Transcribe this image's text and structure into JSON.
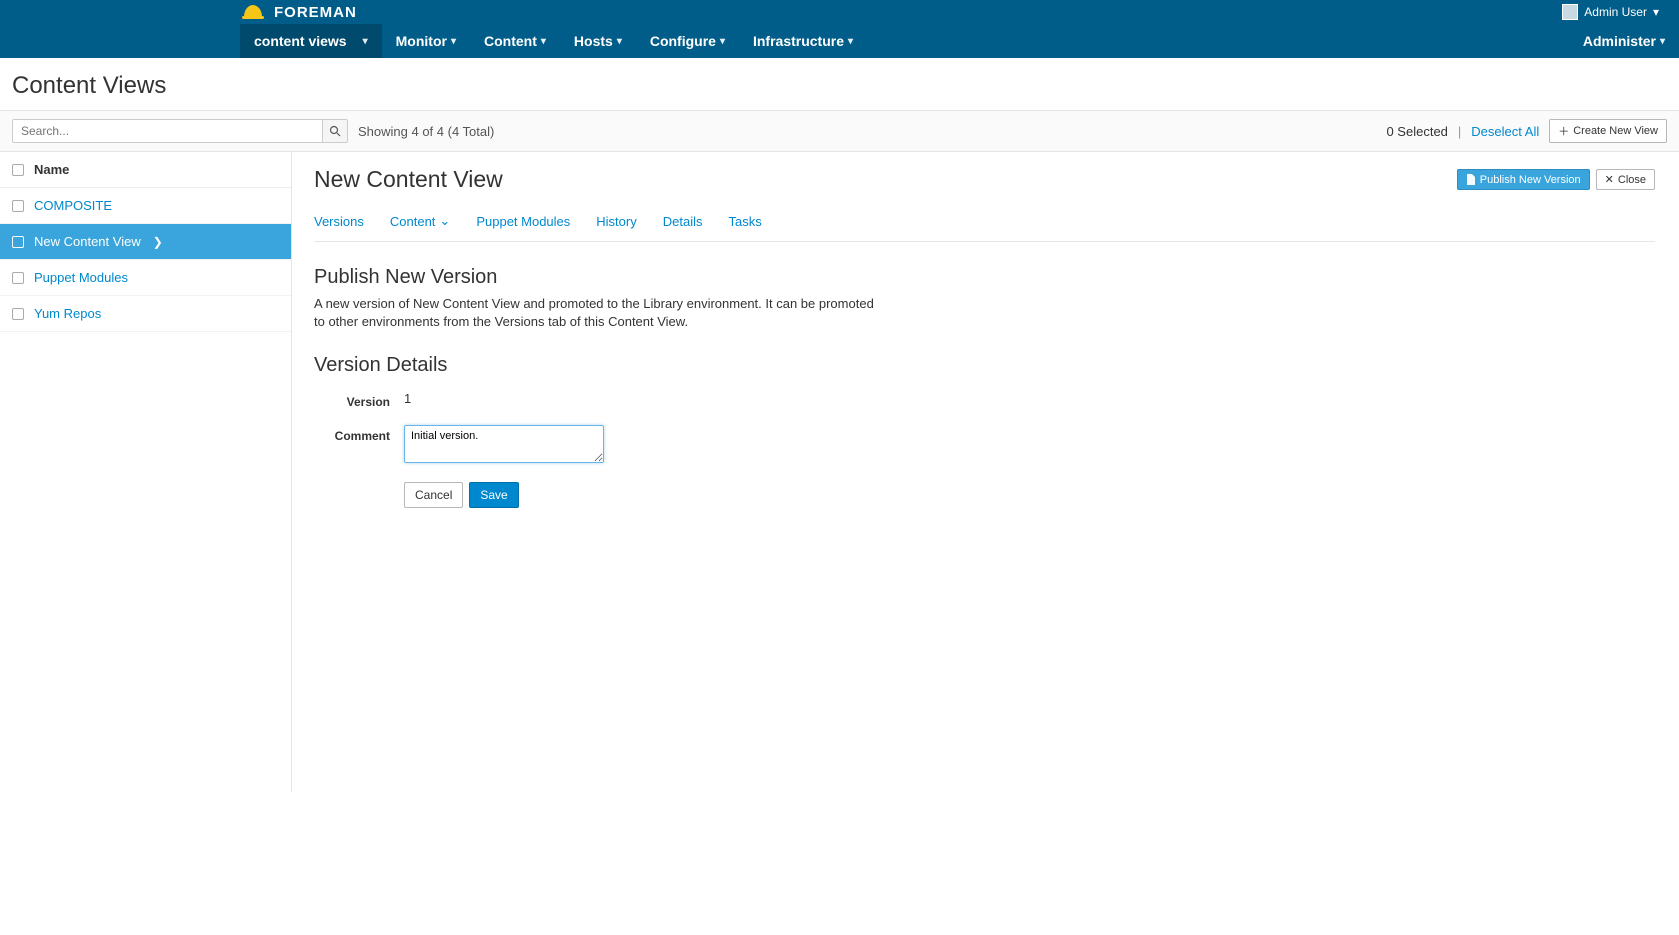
{
  "brand": "FOREMAN",
  "user_label": "Admin User",
  "nav": {
    "items": [
      {
        "label": "content views",
        "active": true
      },
      {
        "label": "Monitor"
      },
      {
        "label": "Content"
      },
      {
        "label": "Hosts"
      },
      {
        "label": "Configure"
      },
      {
        "label": "Infrastructure"
      }
    ],
    "admin": "Administer"
  },
  "page_title": "Content Views",
  "search": {
    "placeholder": "Search..."
  },
  "showing": "Showing 4 of 4 (4 Total)",
  "selected_text": "0 Selected",
  "deselect": "Deselect All",
  "create_btn": "Create New View",
  "sidebar": {
    "header": "Name",
    "items": [
      {
        "label": "COMPOSITE"
      },
      {
        "label": "New Content View",
        "selected": true
      },
      {
        "label": "Puppet Modules"
      },
      {
        "label": "Yum Repos"
      }
    ]
  },
  "main": {
    "title": "New Content View",
    "publish_btn": "Publish New Version",
    "close_btn": "Close",
    "tabs": [
      {
        "label": "Versions"
      },
      {
        "label": "Content",
        "dropdown": true
      },
      {
        "label": "Puppet Modules"
      },
      {
        "label": "History"
      },
      {
        "label": "Details"
      },
      {
        "label": "Tasks"
      }
    ],
    "publish_h": "Publish New Version",
    "publish_p": "A new version of New Content View and promoted to the Library environment. It can be promoted to other environments from the Versions tab of this Content View.",
    "details_h": "Version Details",
    "form": {
      "version_label": "Version",
      "version_value": "1",
      "comment_label": "Comment",
      "comment_value": "Initial version.",
      "cancel": "Cancel",
      "save": "Save"
    }
  }
}
